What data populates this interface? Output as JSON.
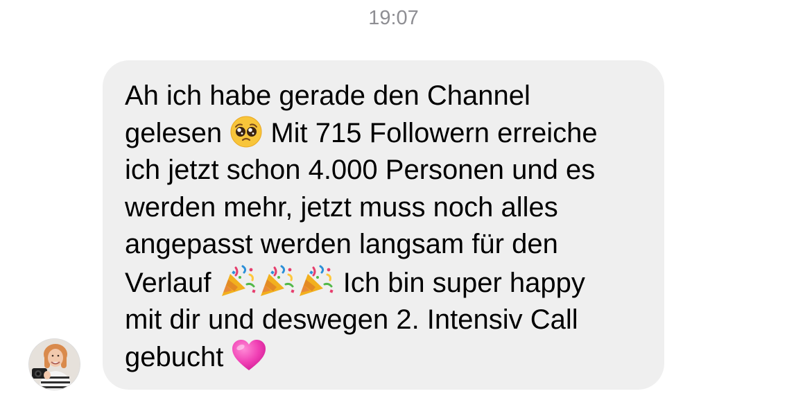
{
  "conversation": {
    "timestamp": "19:07",
    "message": {
      "lines": [
        {
          "text": "Ah ich habe gerade den Channel"
        },
        {
          "before": "gelesen ",
          "after": " Mit 715 Followern erreiche",
          "emoji": "pleading-face-emoji"
        },
        {
          "text": "ich jetzt schon 4.000 Personen und es"
        },
        {
          "text": "werden mehr, jetzt muss noch alles"
        },
        {
          "text": "angepasst werden langsam für den"
        },
        {
          "before": "Verlauf ",
          "after": " Ich bin super happy",
          "emoji": "party-popper-emoji",
          "emoji_count": 3
        },
        {
          "text": "mit dir und deswegen 2. Intensiv Call"
        },
        {
          "before": "gebucht ",
          "emoji": "pink-heart-emoji"
        }
      ]
    },
    "sender": {
      "avatar": "avatar-photo"
    }
  },
  "colors": {
    "timestamp": "#8e8e93",
    "bubble_background": "#efefef",
    "text": "#000000",
    "background": "#ffffff"
  }
}
